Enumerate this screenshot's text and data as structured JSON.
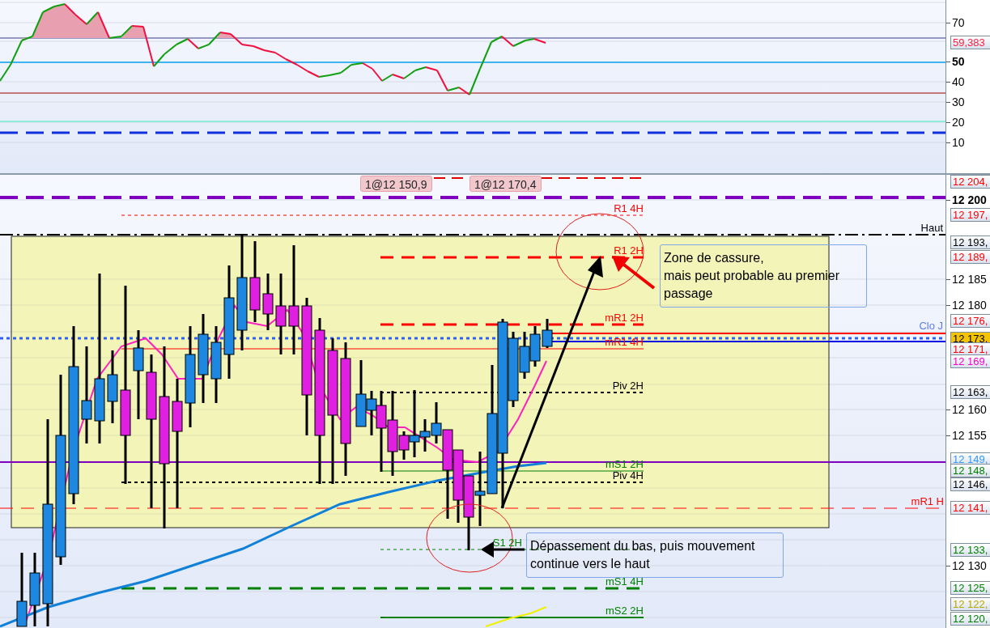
{
  "rsi_panel": {
    "axis_ticks": [
      {
        "text": "70",
        "bold": false
      },
      {
        "text": "50",
        "bold": true
      },
      {
        "text": "40",
        "bold": false
      },
      {
        "text": "30",
        "bold": false
      },
      {
        "text": "20",
        "bold": false
      },
      {
        "text": "10",
        "bold": false
      }
    ],
    "current_value": {
      "text": "59,383",
      "color": "#ff2040"
    }
  },
  "price_panel": {
    "trade_tags": [
      "1@12 150,9",
      "1@12 170,4"
    ],
    "levels": [
      {
        "label": "R1 4H",
        "color": "#ff0000",
        "kind": "dotted"
      },
      {
        "label": "Haut",
        "color": "#000000",
        "kind": "dashdot"
      },
      {
        "label": "R1 2H",
        "color": "#ff0000",
        "kind": "dashed"
      },
      {
        "label": "mR1 2H",
        "color": "#ff0000",
        "kind": "dashed"
      },
      {
        "label": "Clo J",
        "color": "#5b7cf0",
        "kind": "dotted"
      },
      {
        "label": "mR1 4H",
        "color": "#ff0000",
        "kind": "solid"
      },
      {
        "label": "Piv 2H",
        "color": "#000000",
        "kind": "dotted"
      },
      {
        "label": "mS1 2H",
        "color": "#008000",
        "kind": "solid"
      },
      {
        "label": "Piv 4H",
        "color": "#000000",
        "kind": "dotted"
      },
      {
        "label": "mR1 H",
        "color": "#ff0000",
        "kind": "dashed"
      },
      {
        "label": "S1 2H",
        "color": "#008000",
        "kind": "dotted"
      },
      {
        "label": "mS1 4H",
        "color": "#008000",
        "kind": "dashed"
      },
      {
        "label": "mS2 2H",
        "color": "#008000",
        "kind": "solid"
      }
    ],
    "axis_ticks": [
      {
        "text": "12 200",
        "bold": true
      },
      {
        "text": "12 185",
        "bold": false
      },
      {
        "text": "12 180",
        "bold": false
      },
      {
        "text": "12 160",
        "bold": false
      },
      {
        "text": "12 155",
        "bold": false
      },
      {
        "text": "12 130",
        "bold": false
      }
    ],
    "price_tags": [
      {
        "text": "12 204,",
        "color": "#ff0000",
        "kind": "level"
      },
      {
        "text": "12 197,",
        "color": "#ff0000",
        "kind": "level"
      },
      {
        "text": "12 193,",
        "color": "#000000",
        "kind": "level"
      },
      {
        "text": "12 189,",
        "color": "#ff0000",
        "kind": "level"
      },
      {
        "text": "12 176,",
        "color": "#ff0000",
        "kind": "level"
      },
      {
        "text": "12 173,",
        "kind": "current"
      },
      {
        "text": "12 171,",
        "color": "#ff0000",
        "kind": "level"
      },
      {
        "text": "12 169,",
        "color": "#ff00cc",
        "kind": "level"
      },
      {
        "text": "12 163,",
        "color": "#000000",
        "kind": "level"
      },
      {
        "text": "12 149,",
        "color": "#3399ff",
        "kind": "level"
      },
      {
        "text": "12 148,",
        "color": "#008000",
        "kind": "level"
      },
      {
        "text": "12 146,",
        "color": "#000000",
        "kind": "level"
      },
      {
        "text": "12 141,",
        "color": "#ff0000",
        "kind": "level"
      },
      {
        "text": "12 133,",
        "color": "#008000",
        "kind": "level"
      },
      {
        "text": "12 125,",
        "color": "#008000",
        "kind": "level"
      },
      {
        "text": "12 122,",
        "color": "#b8a800",
        "kind": "level"
      },
      {
        "text": "12 120,",
        "color": "#008000",
        "kind": "level"
      }
    ],
    "annotations": [
      "Zone de cassure,\nmais peut probable au premier passage",
      "Dépassement du bas, puis mouvement continue vers le haut"
    ]
  }
}
